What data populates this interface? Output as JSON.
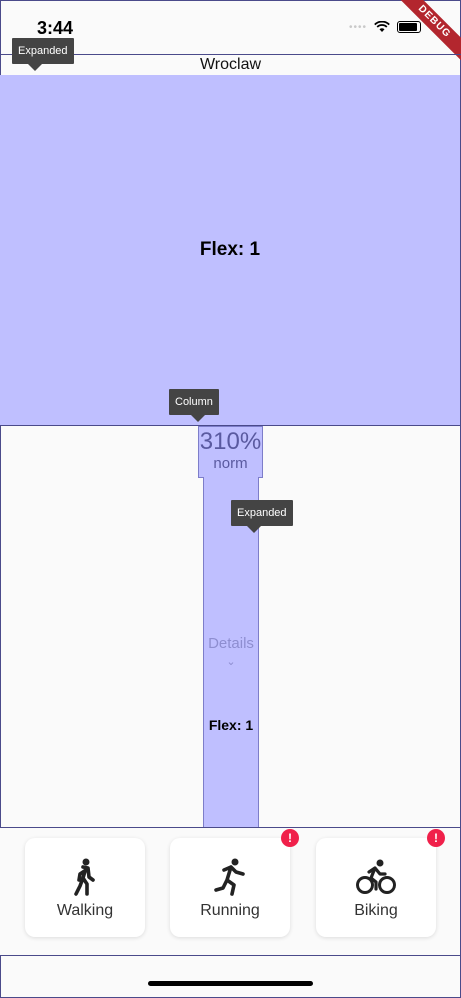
{
  "status": {
    "time": "3:44",
    "dots": "••••"
  },
  "debug_banner": "DEBUG",
  "app": {
    "title": "Wroclaw"
  },
  "tooltips": {
    "expanded_top": "Expanded",
    "column": "Column",
    "expanded_bottom": "Expanded"
  },
  "top_panel": {
    "flex_label": "Flex: 1"
  },
  "column_widget": {
    "percent": "310%",
    "norm": "norm"
  },
  "bottom_panel": {
    "details": "Details",
    "chevron": "⌄",
    "flex_label": "Flex: 1"
  },
  "activities": [
    {
      "label": "Walking",
      "icon": "walking-icon",
      "badge": null
    },
    {
      "label": "Running",
      "icon": "running-icon",
      "badge": "!"
    },
    {
      "label": "Biking",
      "icon": "biking-icon",
      "badge": "!"
    }
  ],
  "colors": {
    "accent": "#bfbfff",
    "badge": "#f0204a",
    "tooltip": "#444444"
  }
}
